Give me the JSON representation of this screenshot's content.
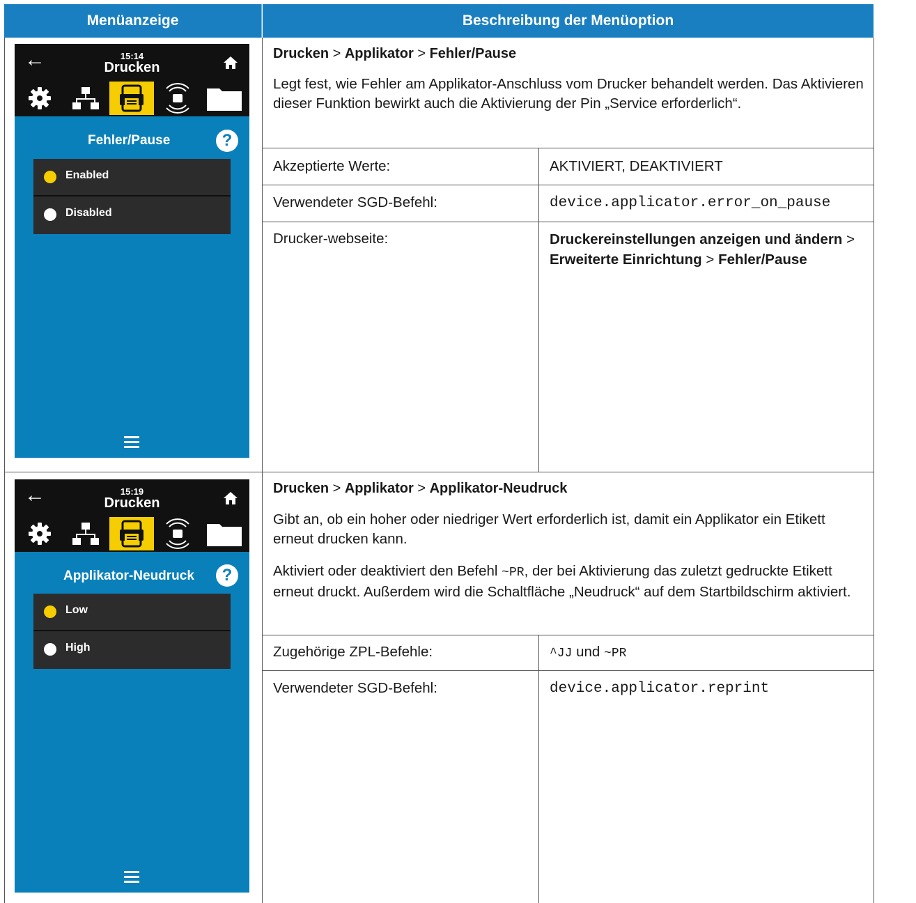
{
  "header": {
    "col1": "Menüanzeige",
    "col2": "Beschreibung der Menüoption"
  },
  "rows": [
    {
      "screen": {
        "time": "15:14",
        "title": "Drucken",
        "selection_label": "Fehler/Pause",
        "options": [
          {
            "label": "Enabled",
            "selected": true
          },
          {
            "label": "Disabled",
            "selected": false
          }
        ]
      },
      "breadcrumb": [
        "Drucken",
        "Applikator",
        "Fehler/Pause"
      ],
      "description": "Legt fest, wie Fehler am Applikator-Anschluss vom Drucker behandelt werden. Das Aktivieren dieser Funktion bewirkt auch die Aktivierung der Pin „Service erforderlich“.",
      "details": [
        {
          "label": "Akzeptierte Werte:",
          "value": "AKTIVIERT, DEAKTIVIERT"
        },
        {
          "label": "Verwendeter SGD-Befehl:",
          "value": "device.applicator.error_on_pause"
        },
        {
          "label": "Drucker-webseite:",
          "value_parts": [
            "Druckereinstellungen anzeigen und ändern",
            " > ",
            "Erweiterte Einrichtung",
            " > ",
            "Fehler/Pause"
          ]
        }
      ]
    },
    {
      "screen": {
        "time": "15:19",
        "title": "Drucken",
        "selection_label": "Applikator-Neudruck",
        "options": [
          {
            "label": "Low",
            "selected": true
          },
          {
            "label": "High",
            "selected": false
          }
        ]
      },
      "breadcrumb": [
        "Drucken",
        "Applikator",
        "Applikator-Neudruck"
      ],
      "description": "Gibt an, ob ein hoher oder niedriger Wert erforderlich ist, damit ein Applikator ein Etikett erneut drucken kann.",
      "description2_parts": [
        "Aktiviert oder deaktiviert den Befehl ",
        "~PR",
        ", der bei Aktivierung das zuletzt gedruckte Etikett erneut druckt. Außerdem wird die Schaltfläche „Neudruck“ auf dem Startbildschirm aktiviert."
      ],
      "details": [
        {
          "label": "Zugehörige ZPL-Befehle:",
          "value_parts": [
            "^JJ",
            " und ",
            "~PR"
          ]
        },
        {
          "label": "Verwendeter SGD-Befehl:",
          "value": "device.applicator.reprint"
        }
      ]
    }
  ],
  "breadcrumb_separator": ">",
  "colors": {
    "header_bg": "#1a7fc1",
    "screen_bg": "#0a80bb",
    "accent_yellow": "#f5cd00",
    "bar_black": "#111111"
  },
  "icons": [
    "back-arrow-icon",
    "home-icon",
    "gear-icon",
    "network-icon",
    "printer-icon",
    "wireless-icon",
    "folder-icon",
    "help-icon",
    "menu-icon"
  ]
}
